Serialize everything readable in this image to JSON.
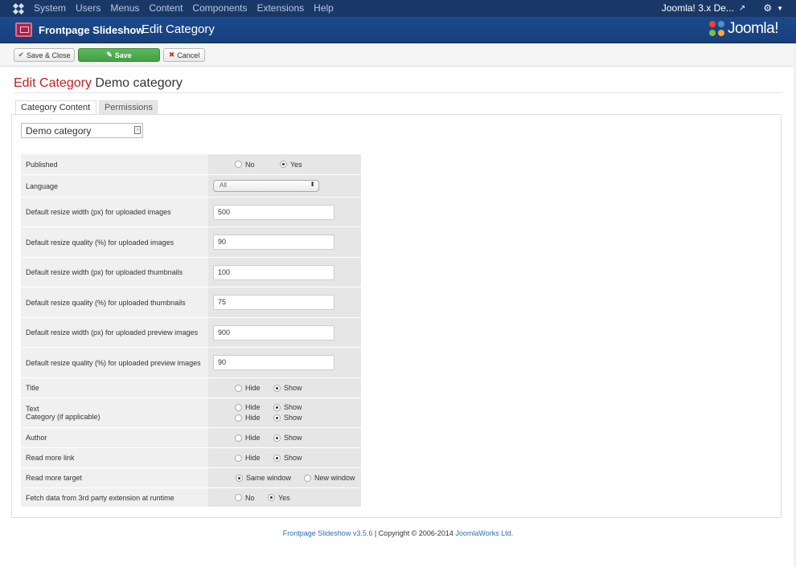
{
  "topbar": {
    "menu": [
      "System",
      "Users",
      "Menus",
      "Content",
      "Components",
      "Extensions",
      "Help"
    ],
    "site_name": "Joomla! 3.x De..."
  },
  "header": {
    "component": "Frontpage Slideshow",
    "page": "Edit Category",
    "brand": "Joomla!"
  },
  "toolbar": {
    "save_close": "Save & Close",
    "save": "Save",
    "cancel": "Cancel"
  },
  "heading": {
    "prefix": "Edit Category",
    "name": "Demo category"
  },
  "tabs": [
    "Category Content",
    "Permissions"
  ],
  "category_name": "Demo category",
  "params": {
    "published": {
      "label": "Published",
      "options": [
        "No",
        "Yes"
      ],
      "selected": "Yes"
    },
    "language": {
      "label": "Language",
      "value": "All"
    },
    "width_images": {
      "label": "Default resize width (px) for uploaded images",
      "value": "500"
    },
    "quality_images": {
      "label": "Default resize quality (%) for uploaded images",
      "value": "90"
    },
    "width_thumbs": {
      "label": "Default resize width (px) for uploaded thumbnails",
      "value": "100"
    },
    "quality_thumbs": {
      "label": "Default resize quality (%) for uploaded thumbnails",
      "value": "75"
    },
    "width_preview": {
      "label": "Default resize width (px) for uploaded preview images",
      "value": "900"
    },
    "quality_preview": {
      "label": "Default resize quality (%) for uploaded preview images",
      "value": "90"
    },
    "title": {
      "label": "Title",
      "options": [
        "Hide",
        "Show"
      ],
      "selected": "Show"
    },
    "text": {
      "label": "Text",
      "options": [
        "Hide",
        "Show"
      ],
      "selected": "Show"
    },
    "category": {
      "label": "Category (if applicable)",
      "options": [
        "Hide",
        "Show"
      ],
      "selected": "Show"
    },
    "author": {
      "label": "Author",
      "options": [
        "Hide",
        "Show"
      ],
      "selected": "Show"
    },
    "readmore": {
      "label": "Read more link",
      "options": [
        "Hide",
        "Show"
      ],
      "selected": "Show"
    },
    "readmore_target": {
      "label": "Read more target",
      "options": [
        "Same window",
        "New window"
      ],
      "selected": "Same window"
    },
    "fetch": {
      "label": "Fetch data from 3rd party extension at runtime",
      "options": [
        "No",
        "Yes"
      ],
      "selected": "Yes"
    }
  },
  "footer": {
    "product": "Frontpage Slideshow v3.5.6",
    "copyright": " | Copyright © 2006-2014 ",
    "company": "JoomlaWorks Ltd."
  },
  "colors": {
    "topbar": "#1a3867",
    "header": "#1c4a8c",
    "save_green": "#4cae4c",
    "heading_red": "#c02020",
    "link": "#2a6eb8"
  }
}
